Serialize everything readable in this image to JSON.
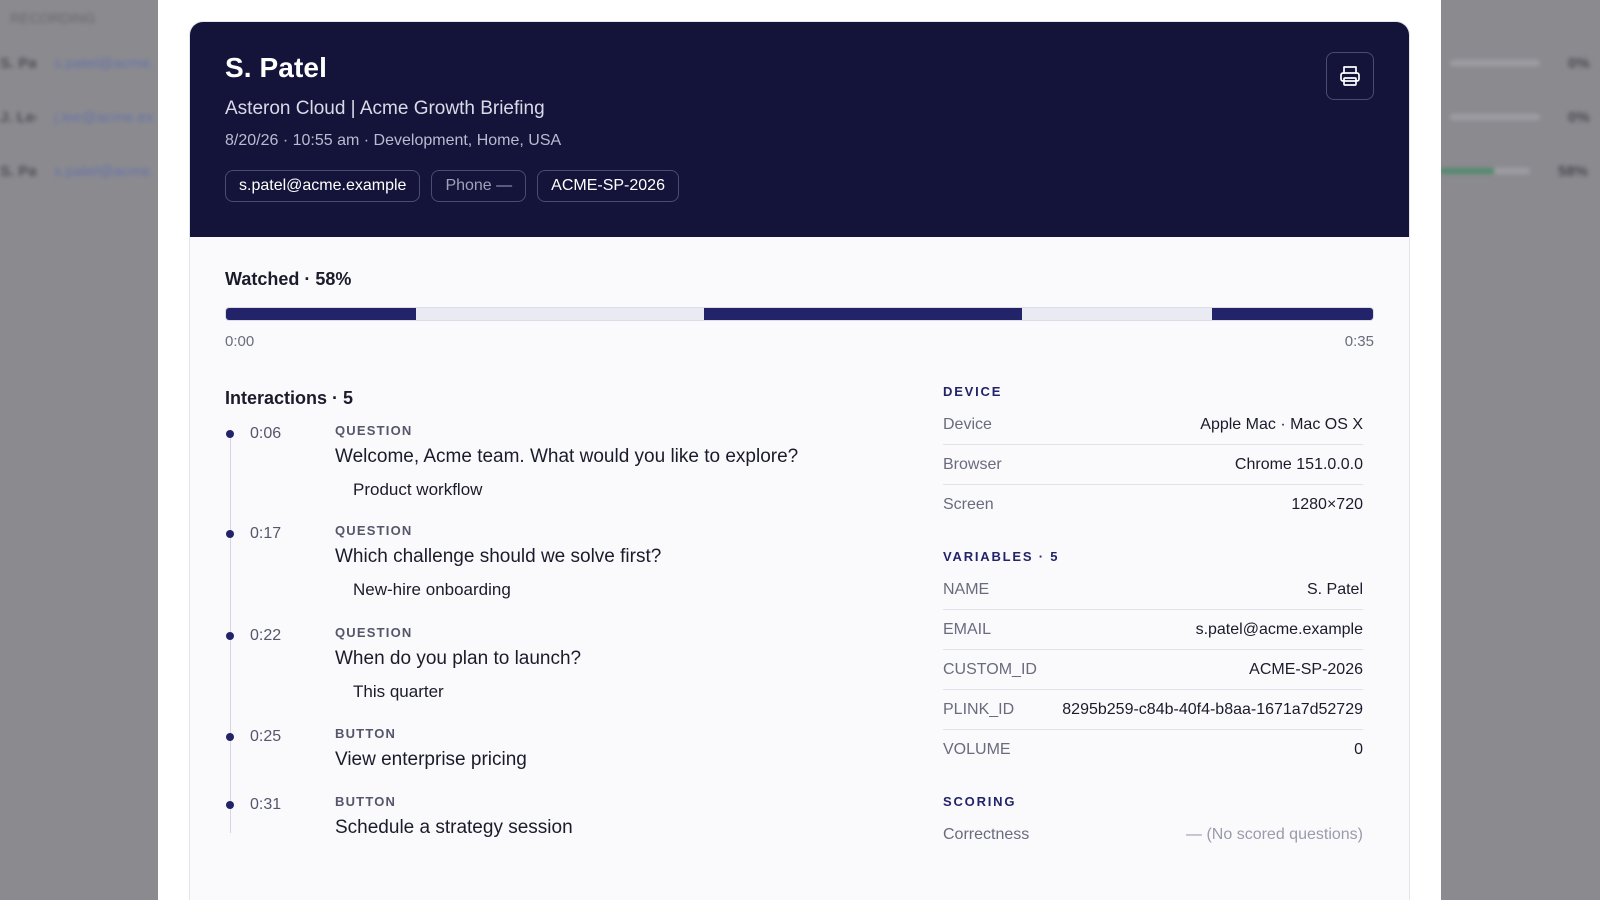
{
  "background": {
    "title": "RECORDING",
    "rows": [
      {
        "name": "S. Patel",
        "email": "s.patel@acme.example",
        "value": "0%"
      },
      {
        "name": "J. Lee",
        "email": "j.lee@acme.example",
        "value": "0%"
      },
      {
        "name": "S. Patel",
        "email": "s.patel@acme.example",
        "value": "58%"
      }
    ]
  },
  "header": {
    "name": "S. Patel",
    "subtitle": "Asteron Cloud | Acme Growth Briefing",
    "meta": "8/20/26 · 10:55 am · Development, Home, USA",
    "chips": [
      "s.patel@acme.example",
      "Phone —",
      "ACME-SP-2026"
    ],
    "print_icon": "printer-icon"
  },
  "watched": {
    "label": "Watched · 58%",
    "percent": 58,
    "start_label": "0:00",
    "end_label": "0:35",
    "duration_seconds": 35,
    "watched_ranges_seconds": [
      [
        0,
        5.8
      ],
      [
        14.6,
        24.3
      ],
      [
        30.1,
        35
      ]
    ]
  },
  "interactions": {
    "title": "Interactions · 5",
    "items": [
      {
        "time": "0:06",
        "type": "QUESTION",
        "text": "Welcome, Acme team. What would you like to explore?",
        "answer": "Product workflow"
      },
      {
        "time": "0:17",
        "type": "QUESTION",
        "text": "Which challenge should we solve first?",
        "answer": "New-hire onboarding"
      },
      {
        "time": "0:22",
        "type": "QUESTION",
        "text": "When do you plan to launch?",
        "answer": "This quarter"
      },
      {
        "time": "0:25",
        "type": "BUTTON",
        "text": "View enterprise pricing",
        "answer": ""
      },
      {
        "time": "0:31",
        "type": "BUTTON",
        "text": "Schedule a strategy session",
        "answer": ""
      }
    ]
  },
  "device": {
    "title": "DEVICE",
    "rows": [
      {
        "k": "Device",
        "v": "Apple Mac · Mac OS X"
      },
      {
        "k": "Browser",
        "v": "Chrome 151.0.0.0"
      },
      {
        "k": "Screen",
        "v": "1280×720"
      }
    ]
  },
  "variables": {
    "title": "VARIABLES · 5",
    "rows": [
      {
        "k": "NAME",
        "v": "S. Patel"
      },
      {
        "k": "EMAIL",
        "v": "s.patel@acme.example"
      },
      {
        "k": "CUSTOM_ID",
        "v": "ACME-SP-2026"
      },
      {
        "k": "PLINK_ID",
        "v": "8295b259-c84b-40f4-b8aa-1671a7d52729"
      },
      {
        "k": "VOLUME",
        "v": "0"
      }
    ]
  },
  "scoring": {
    "title": "SCORING",
    "rows": [
      {
        "k": "Correctness",
        "v": "— (No scored questions)"
      }
    ]
  }
}
